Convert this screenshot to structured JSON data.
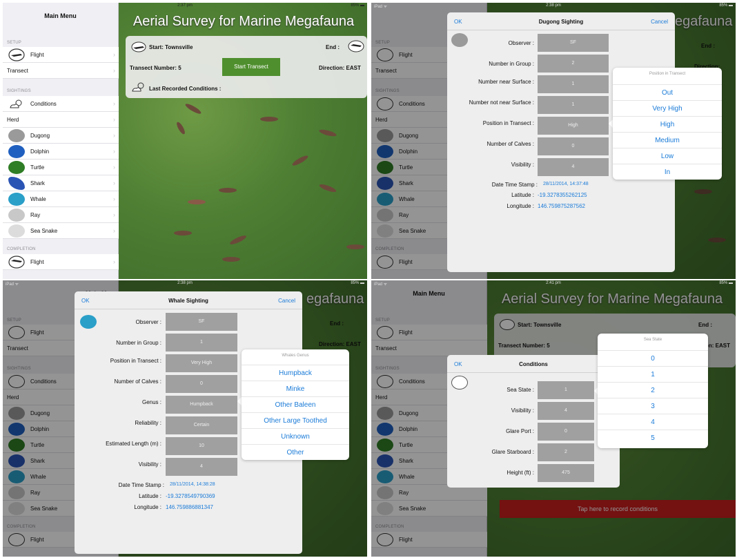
{
  "status": {
    "left": "iPad ᯤ",
    "right": "85% ▬"
  },
  "colors": {
    "accent": "#1a7bd8",
    "green_button": "#4f8f2e",
    "red_button": "#c81e1e",
    "field_gray": "#a0a0a0"
  },
  "panel1": {
    "time": "2:37 pm",
    "sidebar": {
      "title": "Main Menu",
      "sec_setup": "SETUP",
      "sec_sightings": "SIGHTINGS",
      "sec_completion": "COMPLETION",
      "items": [
        "Flight",
        "Transect",
        "Conditions",
        "Herd",
        "Dugong",
        "Dolphin",
        "Turtle",
        "Shark",
        "Whale",
        "Ray",
        "Sea Snake",
        "Flight"
      ],
      "icons": [
        "plane-icon",
        "",
        "sun-cloud-icon",
        "",
        "dugong-icon",
        "dolphin-icon",
        "turtle-icon",
        "shark-icon",
        "whale-icon",
        "ray-icon",
        "sea-snake-icon",
        "plane-icon"
      ]
    },
    "app_title": "Aerial Survey for Marine Megafauna",
    "start": "Start: Townsville",
    "end": "End :",
    "transect_number": "Transect Number: 5",
    "start_transect": "Start Transect",
    "direction": "Direction: EAST",
    "last_conditions": "Last Recorded Conditions :"
  },
  "panel2": {
    "time": "2:38 pm",
    "sidebar_title": "Main Men",
    "bg_title": "egafauna",
    "end": "End :",
    "direction": "Direction: EAST",
    "modal": {
      "ok": "OK",
      "title": "Dugong Sighting",
      "cancel": "Cancel",
      "fields": [
        {
          "label": "Observer :",
          "value": "SF"
        },
        {
          "label": "Number in Group :",
          "value": "2"
        },
        {
          "label": "Number near Surface :",
          "value": "1"
        },
        {
          "label": "Number not near Surface :",
          "value": "1"
        },
        {
          "label": "Position in Transect :",
          "value": "High"
        },
        {
          "label": "Number of Calves :",
          "value": "0"
        },
        {
          "label": "Visibility :",
          "value": "4"
        }
      ],
      "timestamp_label": "Date Time Stamp :",
      "timestamp": "28/11/2014, 14:37:48",
      "lat_label": "Latitude :",
      "lat": "-19.3278355262125",
      "lon_label": "Longitude :",
      "lon": "146.759875287562"
    },
    "popover": {
      "title": "Position in Transect",
      "options": [
        "Out",
        "Very High",
        "High",
        "Medium",
        "Low",
        "In"
      ]
    }
  },
  "panel3": {
    "time": "2:38 pm",
    "sidebar_title": "Main Men",
    "bg_title": "egafauna",
    "end": "End :",
    "direction": "Direction: EAST",
    "modal": {
      "ok": "OK",
      "title": "Whale Sighting",
      "cancel": "Cancel",
      "fields": [
        {
          "label": "Observer :",
          "value": "SF"
        },
        {
          "label": "Number in Group :",
          "value": "1"
        },
        {
          "label": "Position in Transect :",
          "value": "Very High"
        },
        {
          "label": "Number of Calves :",
          "value": "0"
        },
        {
          "label": "Genus :",
          "value": "Humpback"
        },
        {
          "label": "Reliability :",
          "value": "Certain"
        },
        {
          "label": "Estimated Length (m) :",
          "value": "10"
        },
        {
          "label": "Visibility :",
          "value": "4"
        }
      ],
      "timestamp_label": "Date Time Stamp :",
      "timestamp": "28/11/2014, 14:38:28",
      "lat_label": "Latitude :",
      "lat": "-19.3278549790369",
      "lon_label": "Longitude :",
      "lon": "146.759886881347"
    },
    "popover": {
      "title": "Whales Genus",
      "options": [
        "Humpback",
        "Minke",
        "Other Baleen",
        "Other Large Toothed",
        "Unknown",
        "Other"
      ]
    }
  },
  "panel4": {
    "time": "2:41 pm",
    "sidebar_title": "Main Menu",
    "app_title": "Aerial Survey for Marine Megafauna",
    "start": "Start: Townsville",
    "end": "End :",
    "transect_number": "Transect Number: 5",
    "direction": "on: EAST",
    "modal": {
      "ok": "OK",
      "title": "Conditions",
      "fields": [
        {
          "label": "Sea State :",
          "value": "1"
        },
        {
          "label": "Visibility :",
          "value": "4"
        },
        {
          "label": "Glare Port :",
          "value": "0"
        },
        {
          "label": "Glare Starboard :",
          "value": "2"
        },
        {
          "label": "Height (ft) :",
          "value": "475"
        }
      ]
    },
    "popover": {
      "title": "Sea State",
      "options": [
        "0",
        "1",
        "2",
        "3",
        "4",
        "5"
      ]
    },
    "record_button": "Tap here to record conditions"
  }
}
